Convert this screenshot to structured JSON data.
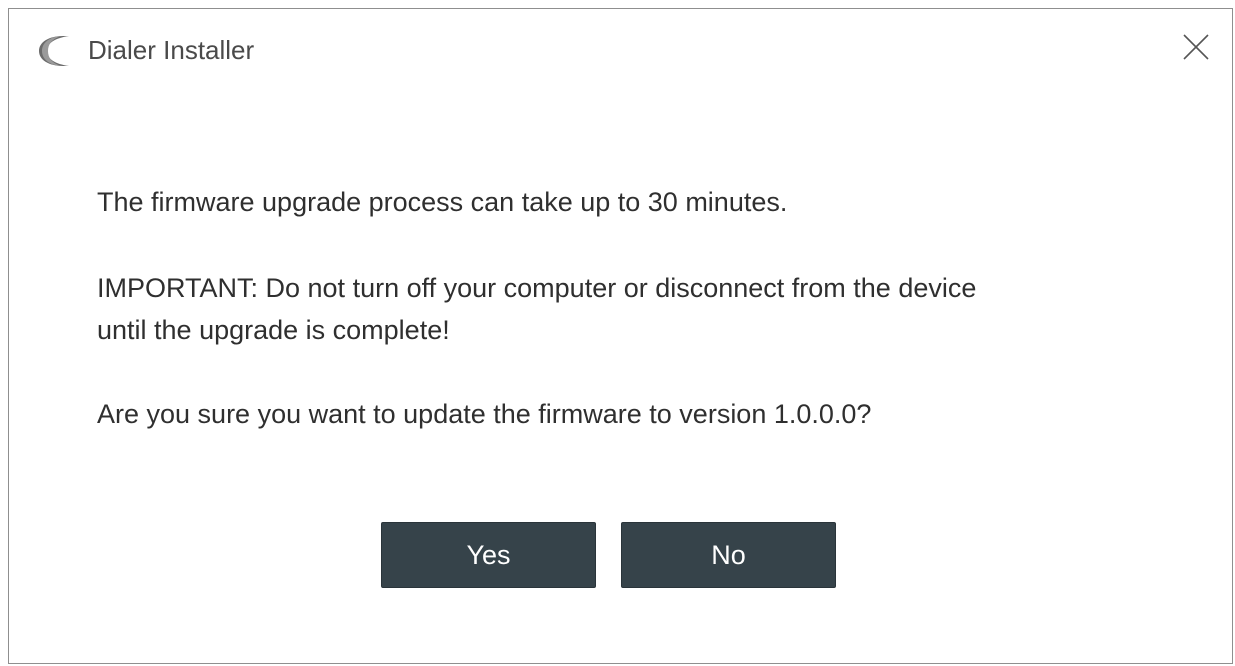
{
  "window": {
    "title": "Dialer Installer",
    "icon": "app-c-logo-icon",
    "close_icon": "close-icon"
  },
  "message": {
    "line1": "The firmware upgrade process can take up to 30 minutes.",
    "line2": "IMPORTANT: Do not turn off your computer or disconnect from the device",
    "line3": "until the upgrade is complete!",
    "line4": "Are you sure you want to update the firmware to version 1.0.0.0?"
  },
  "buttons": {
    "yes_label": "Yes",
    "no_label": "No"
  },
  "colors": {
    "button_bg": "#36434a",
    "button_text": "#ffffff",
    "border": "#8f8f8f",
    "text": "#2f2f2f"
  }
}
